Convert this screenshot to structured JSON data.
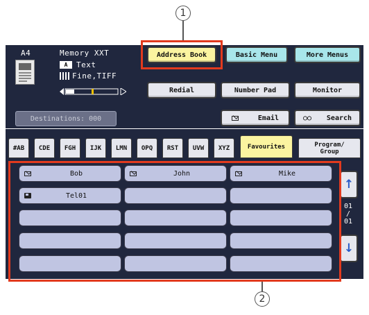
{
  "callouts": {
    "one": "1",
    "two": "2"
  },
  "status": {
    "paper": "A4",
    "memory": "Memory XXT",
    "mode": "Text",
    "quality": "Fine,TIFF",
    "destinations": "Destinations: 000"
  },
  "top_buttons": {
    "address_book": "Address Book",
    "basic_menu": "Basic Menu",
    "more_menus": "More Menus",
    "redial": "Redial",
    "number_pad": "Number Pad",
    "monitor": "Monitor",
    "email": "Email",
    "search": "Search"
  },
  "tabs": [
    "#AB",
    "CDE",
    "FGH",
    "IJK",
    "LMN",
    "OPQ",
    "RST",
    "UVW",
    "XYZ",
    "Favourites",
    "Program/ Group"
  ],
  "active_tab": "Favourites",
  "entries": [
    {
      "label": "Bob",
      "icon": "email-icon"
    },
    {
      "label": "John",
      "icon": "email-icon"
    },
    {
      "label": "Mike",
      "icon": "email-icon"
    },
    {
      "label": "Tel01",
      "icon": "fax-icon"
    }
  ],
  "pager": {
    "current": "01",
    "separator": "/",
    "total": "01"
  },
  "colors": {
    "panel": "#20273e",
    "accent_yellow": "#fbf4a0",
    "accent_cyan": "#a8e6ea",
    "highlight": "#e23a1e",
    "cell": "#c0c5e2"
  }
}
